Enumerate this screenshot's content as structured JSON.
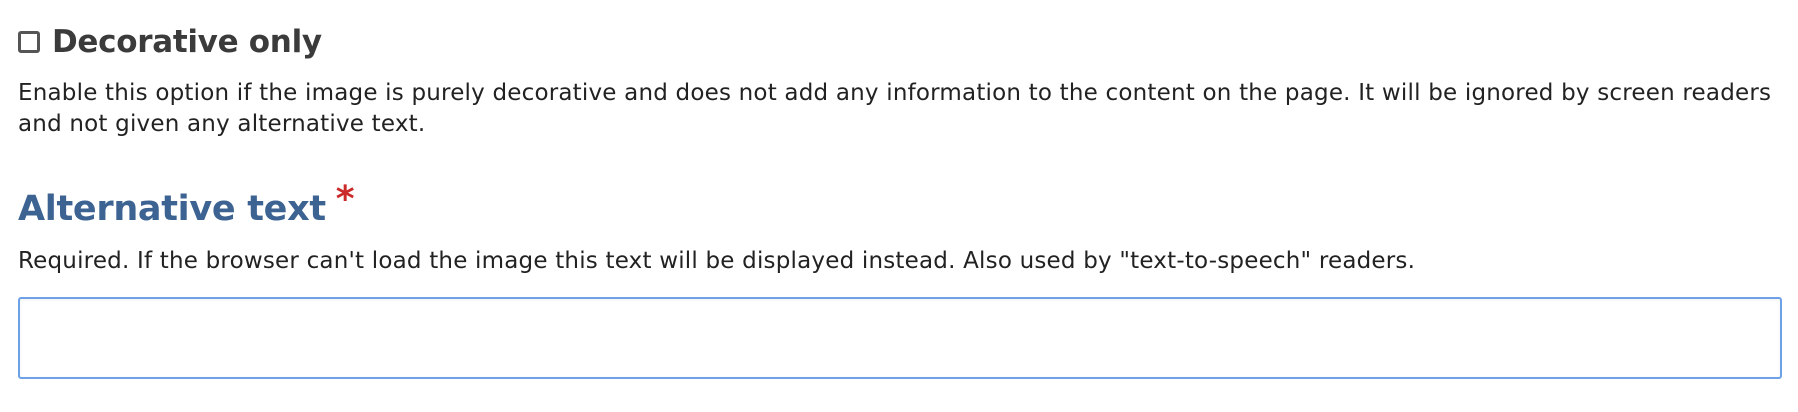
{
  "decorative": {
    "label": "Decorative only",
    "checked": false,
    "help": "Enable this option if the image is purely decorative and does not add any information to the content on the page. It will be ignored by screen readers and not given any alternative text."
  },
  "alt_text": {
    "label": "Alternative text",
    "required_marker": "*",
    "help": "Required. If the browser can't load the image this text will be displayed instead. Also used by \"text-to-speech\" readers.",
    "value": ""
  },
  "colors": {
    "label_blue": "#3d6392",
    "required_red": "#cc2a2a",
    "input_border": "#6fa1e6"
  }
}
